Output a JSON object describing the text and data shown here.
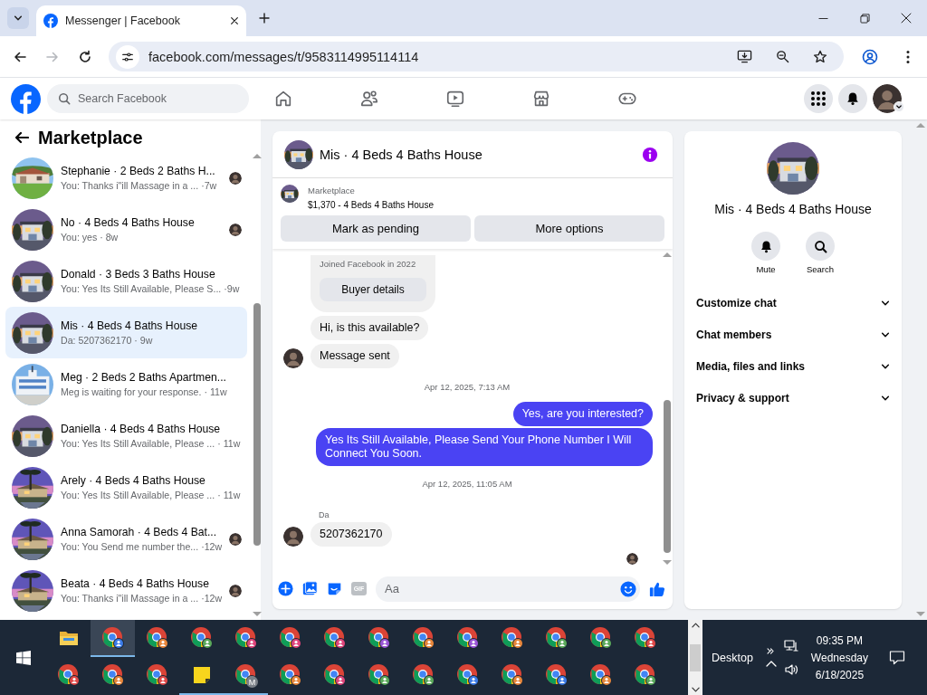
{
  "browser": {
    "tab": {
      "title": "Messenger | Facebook"
    },
    "nav_buttons": [
      {
        "kind": "back",
        "disabled": false
      },
      {
        "kind": "forward",
        "disabled": true
      },
      {
        "kind": "reload",
        "disabled": false
      }
    ],
    "url": "facebook.com/messages/t/9583114995114114"
  },
  "facebook_header": {
    "search": {
      "placeholder": "Search Facebook"
    }
  },
  "sidebar": {
    "title": "Marketplace",
    "conversations": [
      {
        "title": "Stephanie · 2 Beds 2 Baths H...",
        "preview": "You: Thanks i\"ill Massage in a ...",
        "time": "·7w",
        "seen": true,
        "selected": false
      },
      {
        "title": "No · 4 Beds 4 Baths House",
        "preview": "You: yes",
        "time": "· 8w",
        "seen": true,
        "selected": false
      },
      {
        "title": "Donald · 3 Beds 3 Baths House",
        "preview": "You: Yes Its Still Available, Please S...",
        "time": "·9w",
        "seen": false,
        "selected": false
      },
      {
        "title": "Mis · 4 Beds 4 Baths House",
        "preview": "Da: 5207362170",
        "time": "· 9w",
        "seen": false,
        "selected": true
      },
      {
        "title": "Meg · 2 Beds 2 Baths Apartmen...",
        "preview": "Meg is waiting for your response.",
        "time": "· 11w",
        "seen": false,
        "selected": false
      },
      {
        "title": "Daniella · 4 Beds 4 Baths House",
        "preview": "You: Yes Its Still Available, Please ...",
        "time": "· 11w",
        "seen": false,
        "selected": false
      },
      {
        "title": "Arely · 4 Beds 4 Baths House",
        "preview": "You: Yes Its Still Available, Please ...",
        "time": "· 11w",
        "seen": false,
        "selected": false
      },
      {
        "title": "Anna Samorah · 4 Beds 4 Bat...",
        "preview": "You: You Send me number the...",
        "time": "·12w",
        "seen": true,
        "selected": false
      },
      {
        "title": "Beata · 4 Beds 4 Baths House",
        "preview": "You: Thanks i\"ill Massage in a ...",
        "time": "·12w",
        "seen": true,
        "selected": false
      }
    ]
  },
  "chat": {
    "title": "Mis · 4 Beds 4 Baths House",
    "listing": {
      "label": "Marketplace",
      "summary": "$1,370 - 4 Beds 4 Baths House"
    },
    "actions": [
      "Mark as pending",
      "More options"
    ],
    "messages": [
      {
        "kind": "card",
        "text": "Joined Facebook in 2022",
        "button": "Buyer details"
      },
      {
        "kind": "incoming",
        "text": "Hi, is this available?",
        "avatar": false
      },
      {
        "kind": "incoming",
        "text": "Message sent",
        "avatar": true
      },
      {
        "kind": "timestamp",
        "text": "Apr 12, 2025, 7:13 AM"
      },
      {
        "kind": "outgoing",
        "text": "Yes, are you interested?"
      },
      {
        "kind": "outgoing",
        "text": "Yes Its Still Available, Please Send Your Phone Number I Will Connect You Soon."
      },
      {
        "kind": "timestamp",
        "text": "Apr 12, 2025, 11:05 AM"
      },
      {
        "kind": "sender",
        "text": "Da"
      },
      {
        "kind": "incoming",
        "text": "5207362170",
        "avatar": true
      },
      {
        "kind": "seen"
      }
    ],
    "composer": {
      "gif_label": "GIF",
      "placeholder": "Aa"
    }
  },
  "details": {
    "name": "Mis · 4 Beds 4 Baths House",
    "actions": [
      {
        "kind": "mute",
        "label": "Mute"
      },
      {
        "kind": "search",
        "label": "Search"
      }
    ],
    "sections": [
      {
        "label": "Customize chat",
        "expanded": false
      },
      {
        "label": "Chat members",
        "expanded": false
      },
      {
        "label": "Media, files and links",
        "expanded": false
      },
      {
        "label": "Privacy & support",
        "expanded": false
      }
    ]
  },
  "taskbar": {
    "rows": [
      [
        {
          "kind": "folder",
          "selected": false,
          "running": false
        },
        {
          "kind": "chrome",
          "color": "#3b7be8",
          "selected": true,
          "running": true
        },
        {
          "kind": "chrome",
          "color": "#e8863a",
          "selected": false,
          "running": false
        },
        {
          "kind": "chrome",
          "color": "#5aa95a",
          "selected": false,
          "running": false
        },
        {
          "kind": "chrome",
          "color": "#e0457b",
          "selected": false,
          "running": false
        },
        {
          "kind": "chrome",
          "color": "#e0457b",
          "selected": false,
          "running": false
        },
        {
          "kind": "chrome",
          "color": "#e0457b",
          "selected": false,
          "running": false
        },
        {
          "kind": "chrome",
          "color": "#9a55d6",
          "selected": false,
          "running": false
        },
        {
          "kind": "chrome",
          "color": "#e8863a",
          "selected": false,
          "running": false
        },
        {
          "kind": "chrome",
          "color": "#9a55d6",
          "selected": false,
          "running": false
        },
        {
          "kind": "chrome",
          "color": "#e8863a",
          "selected": false,
          "running": false
        },
        {
          "kind": "chrome",
          "color": "#5aa95a",
          "selected": false,
          "running": false
        },
        {
          "kind": "chrome",
          "color": "#5aa95a",
          "selected": false,
          "running": false
        },
        {
          "kind": "chrome",
          "color": "#e04848",
          "selected": false,
          "running": false
        }
      ],
      [
        {
          "kind": "chrome",
          "color": "#e04848",
          "selected": false,
          "running": false
        },
        {
          "kind": "chrome",
          "color": "#e8863a",
          "selected": false,
          "running": false
        },
        {
          "kind": "chrome",
          "color": "#e04848",
          "selected": false,
          "running": false
        },
        {
          "kind": "notes",
          "selected": false,
          "running": true
        },
        {
          "kind": "chrome",
          "color": "#7a8088",
          "label": "M",
          "selected": false,
          "running": true
        },
        {
          "kind": "chrome",
          "color": "#e8863a",
          "selected": false,
          "running": false
        },
        {
          "kind": "chrome",
          "color": "#e0457b",
          "selected": false,
          "running": false
        },
        {
          "kind": "chrome",
          "color": "#5aa95a",
          "selected": false,
          "running": false
        },
        {
          "kind": "chrome",
          "color": "#5aa95a",
          "selected": false,
          "running": false
        },
        {
          "kind": "chrome",
          "color": "#3b7be8",
          "selected": false,
          "running": false
        },
        {
          "kind": "chrome",
          "color": "#e8863a",
          "selected": false,
          "running": false
        },
        {
          "kind": "chrome",
          "color": "#3b7be8",
          "selected": false,
          "running": false
        },
        {
          "kind": "chrome",
          "color": "#e8863a",
          "selected": false,
          "running": false
        },
        {
          "kind": "chrome",
          "color": "#5aa95a",
          "selected": false,
          "running": false
        }
      ]
    ],
    "tray": {
      "desktop": "Desktop",
      "time": "09:35 PM",
      "day": "Wednesday",
      "date": "6/18/2025"
    }
  }
}
